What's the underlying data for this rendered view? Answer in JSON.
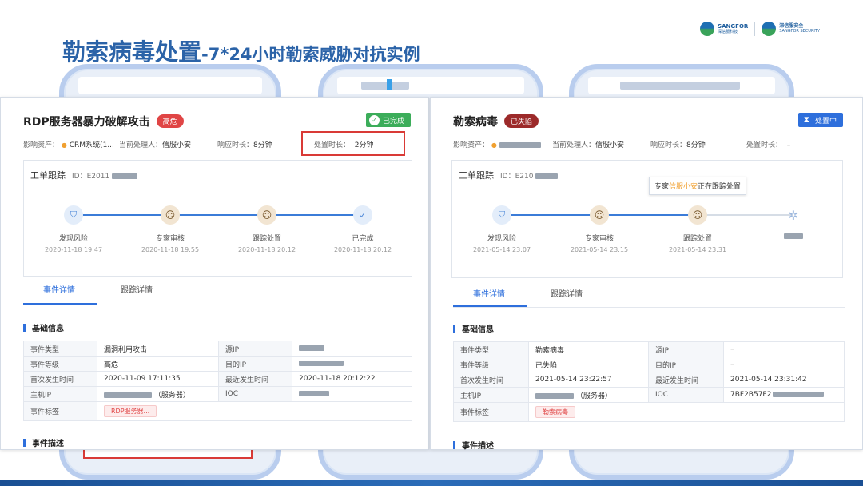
{
  "slide": {
    "title_main": "勒索病毒处置",
    "title_sub": "-7*24小时勒索威胁对抗实例"
  },
  "logos": {
    "sangfor_en": "SANGFOR",
    "sangfor_cn": "深信服科技",
    "security_cn": "深信服安全",
    "security_en": "SANGFOR SECURITY"
  },
  "left_card": {
    "title": "RDP服务器暴力破解攻击",
    "severity_tag": "高危",
    "status": "已完成",
    "meta": {
      "asset_label": "影响资产：",
      "asset_value": "CRM系统(1...",
      "handler_label": "当前处理人：",
      "handler_value": "信服小安",
      "response_label": "响应时长：",
      "response_value": "8分钟",
      "process_label": "处置时长：",
      "process_value": "2分钟"
    },
    "tracking": {
      "title": "工单跟踪",
      "id_label": "ID：E2011",
      "steps": [
        {
          "label": "发现风险",
          "time": "2020-11-18 19:47",
          "icon": "shield-icon"
        },
        {
          "label": "专家审核",
          "time": "2020-11-18 19:55",
          "icon": "expert-avatar-icon"
        },
        {
          "label": "跟踪处置",
          "time": "2020-11-18 20:12",
          "icon": "expert-avatar-icon"
        },
        {
          "label": "已完成",
          "time": "2020-11-18 20:12",
          "icon": "check-circle-icon"
        }
      ]
    },
    "tabs": [
      "事件详情",
      "跟踪详情"
    ],
    "basic_info_title": "基础信息",
    "table": {
      "event_type_label": "事件类型",
      "event_type": "漏洞利用攻击",
      "src_ip_label": "源IP",
      "level_label": "事件等级",
      "level": "高危",
      "dst_ip_label": "目的IP",
      "first_time_label": "首次发生时间",
      "first_time": "2020-11-09 17:11:35",
      "last_time_label": "最近发生时间",
      "last_time": "2020-11-18 20:12:22",
      "host_ip_label": "主机IP",
      "host_ip_suffix": "（服务器）",
      "ioc_label": "IOC",
      "tags_label": "事件标签",
      "tag_chip": "RDP服务器..."
    },
    "desc_title": "事件描述"
  },
  "right_card": {
    "title": "勒索病毒",
    "severity_tag": "已失陷",
    "status": "处置中",
    "meta": {
      "asset_label": "影响资产：",
      "handler_label": "当前处理人：",
      "handler_value": "信服小安",
      "response_label": "响应时长：",
      "response_value": "8分钟",
      "process_label": "处置时长：",
      "process_value": "–"
    },
    "tracking": {
      "title": "工单跟踪",
      "id_label": "ID：E210",
      "tooltip_prefix": "专家",
      "tooltip_name": "信服小安",
      "tooltip_suffix": "正在跟踪处置",
      "steps": [
        {
          "label": "发现风险",
          "time": "2021-05-14 23:07",
          "icon": "shield-icon"
        },
        {
          "label": "专家审核",
          "time": "2021-05-14 23:15",
          "icon": "expert-avatar-icon"
        },
        {
          "label": "跟踪处置",
          "time": "2021-05-14 23:31",
          "icon": "expert-avatar-icon"
        },
        {
          "label": "",
          "time": "",
          "icon": "pending-icon"
        }
      ]
    },
    "tabs": [
      "事件详情",
      "跟踪详情"
    ],
    "basic_info_title": "基础信息",
    "table": {
      "event_type_label": "事件类型",
      "event_type": "勒索病毒",
      "src_ip_label": "源IP",
      "src_ip": "–",
      "level_label": "事件等级",
      "level": "已失陷",
      "dst_ip_label": "目的IP",
      "dst_ip": "–",
      "first_time_label": "首次发生时间",
      "first_time": "2021-05-14 23:22:57",
      "last_time_label": "最近发生时间",
      "last_time": "2021-05-14 23:31:42",
      "host_ip_label": "主机IP",
      "host_ip_suffix": "（服务器）",
      "ioc_label": "IOC",
      "ioc": "7BF2B57F2",
      "tags_label": "事件标签",
      "tag_chip": "勒索病毒"
    },
    "desc_title": "事件描述"
  },
  "colors": {
    "title_blue": "#2b63a8",
    "accent_blue": "#2e6fdc",
    "danger_red": "#e04545",
    "done_green": "#3cad5a",
    "highlight_box": "#d93a36"
  }
}
